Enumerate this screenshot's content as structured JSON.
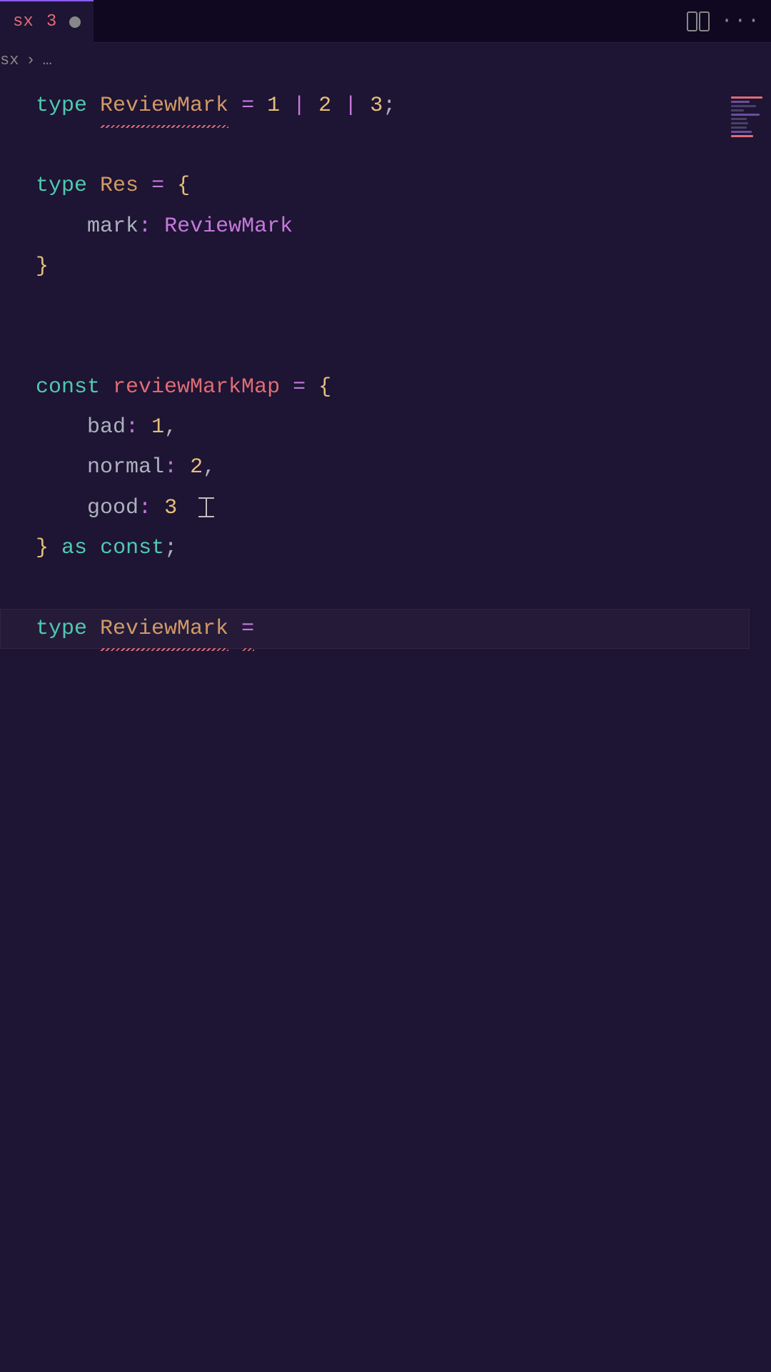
{
  "tab": {
    "ext": "sx",
    "badge": "3"
  },
  "breadcrumb": {
    "ext": "sx",
    "chevron": "›",
    "more": "…"
  },
  "code": {
    "l1": {
      "type": "type",
      "name": "ReviewMark",
      "eq": "=",
      "v1": "1",
      "pipe": "|",
      "v2": "2",
      "v3": "3",
      "semi": ";"
    },
    "l2": {
      "type": "type",
      "name": "Res",
      "eq": "=",
      "brace": "{"
    },
    "l3": {
      "indent": "    ",
      "prop": "mark",
      "colon": ":",
      "typeref": "ReviewMark"
    },
    "l4": {
      "brace": "}"
    },
    "l5": {
      "const": "const",
      "name": "reviewMarkMap",
      "eq": "=",
      "brace": "{"
    },
    "l6": {
      "indent": "    ",
      "prop": "bad",
      "colon": ":",
      "val": "1",
      "comma": ","
    },
    "l7": {
      "indent": "    ",
      "prop": "normal",
      "colon": ":",
      "val": "2",
      "comma": ","
    },
    "l8": {
      "indent": "    ",
      "prop": "good",
      "colon": ":",
      "val": "3"
    },
    "l9": {
      "brace": "}",
      "as": "as",
      "const": "const",
      "semi": ";"
    },
    "l10": {
      "type": "type",
      "name": "ReviewMark",
      "eq": "="
    }
  }
}
